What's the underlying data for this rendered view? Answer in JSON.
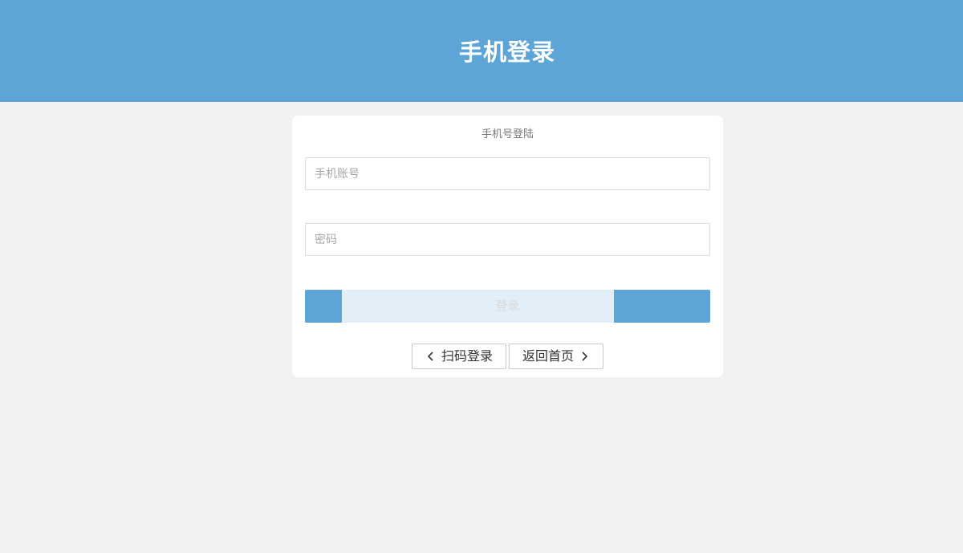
{
  "header": {
    "title": "手机登录"
  },
  "card": {
    "subtitle": "手机号登陆"
  },
  "form": {
    "phone_placeholder": "手机账号",
    "password_placeholder": "密码",
    "login_label": "登录"
  },
  "nav": {
    "scan_login_label": "扫码登录",
    "home_label": "返回首页"
  },
  "colors": {
    "accent": "#5da5d7",
    "page_bg": "#f2f2f2"
  }
}
